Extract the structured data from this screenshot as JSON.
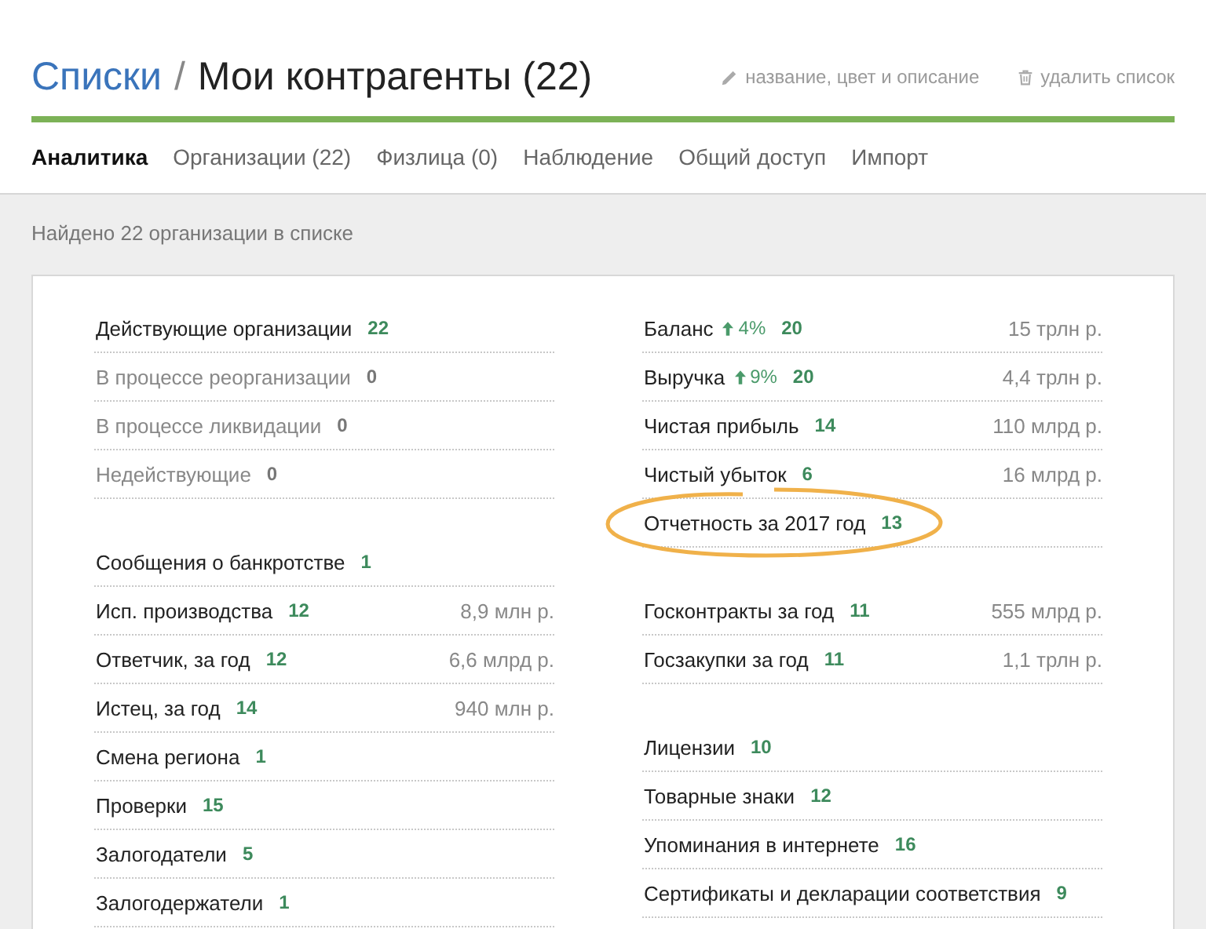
{
  "header": {
    "breadcrumb_link": "Списки",
    "separator": "/",
    "title": "Мои контрагенты (22)",
    "actions": [
      {
        "kind": "edit",
        "label": "название, цвет и описание"
      },
      {
        "kind": "delete",
        "label": "удалить список"
      }
    ]
  },
  "tabs": [
    {
      "label": "Аналитика",
      "selected": true
    },
    {
      "label": "Организации (22)",
      "selected": false
    },
    {
      "label": "Физлица (0)",
      "selected": false
    },
    {
      "label": "Наблюдение",
      "selected": false
    },
    {
      "label": "Общий доступ",
      "selected": false
    },
    {
      "label": "Импорт",
      "selected": false
    }
  ],
  "summary": "Найдено 22 организации в списке",
  "columns": [
    {
      "groups": [
        {
          "rows": [
            {
              "label": "Действующие организации",
              "count": "22",
              "dimmed": false,
              "highlighted": false
            },
            {
              "label": "В процессе реорганизации",
              "count": "0",
              "dimmed": true,
              "highlighted": false
            },
            {
              "label": "В процессе ликвидации",
              "count": "0",
              "dimmed": true,
              "highlighted": false
            },
            {
              "label": "Недействующие",
              "count": "0",
              "dimmed": true,
              "highlighted": false
            }
          ]
        },
        {
          "rows": [
            {
              "label": "Сообщения о банкротстве",
              "count": "1",
              "dimmed": false,
              "highlighted": false
            },
            {
              "label": "Исп. производства",
              "count": "12",
              "amount": "8,9 млн р.",
              "dimmed": false,
              "highlighted": false
            },
            {
              "label": "Ответчик, за год",
              "count": "12",
              "amount": "6,6 млрд р.",
              "dimmed": false,
              "highlighted": false
            },
            {
              "label": "Истец, за год",
              "count": "14",
              "amount": "940 млн р.",
              "dimmed": false,
              "highlighted": false
            },
            {
              "label": "Смена региона",
              "count": "1",
              "dimmed": false,
              "highlighted": false
            },
            {
              "label": "Проверки",
              "count": "15",
              "dimmed": false,
              "highlighted": false
            },
            {
              "label": "Залогодатели",
              "count": "5",
              "dimmed": false,
              "highlighted": false
            },
            {
              "label": "Залогодержатели",
              "count": "1",
              "dimmed": false,
              "highlighted": false
            }
          ]
        }
      ]
    },
    {
      "groups": [
        {
          "rows": [
            {
              "label": "Баланс",
              "change": "4%",
              "count": "20",
              "amount": "15 трлн р.",
              "dimmed": false,
              "highlighted": false
            },
            {
              "label": "Выручка",
              "change": "9%",
              "count": "20",
              "amount": "4,4 трлн р.",
              "dimmed": false,
              "highlighted": false
            },
            {
              "label": "Чистая прибыль",
              "count": "14",
              "amount": "110 млрд р.",
              "dimmed": false,
              "highlighted": false
            },
            {
              "label": "Чистый убыток",
              "count": "6",
              "amount": "16 млрд р.",
              "dimmed": false,
              "highlighted": false
            },
            {
              "label": "Отчетность за 2017 год",
              "count": "13",
              "dimmed": false,
              "highlighted": true
            }
          ]
        },
        {
          "rows": [
            {
              "label": "Госконтракты за год",
              "count": "11",
              "amount": "555 млрд р.",
              "dimmed": false,
              "highlighted": false
            },
            {
              "label": "Госзакупки за год",
              "count": "11",
              "amount": "1,1 трлн р.",
              "dimmed": false,
              "highlighted": false
            }
          ]
        },
        {
          "rows": [
            {
              "label": "Лицензии",
              "count": "10",
              "dimmed": false,
              "highlighted": false
            },
            {
              "label": "Товарные знаки",
              "count": "12",
              "dimmed": false,
              "highlighted": false
            },
            {
              "label": "Упоминания в интернете",
              "count": "16",
              "dimmed": false,
              "highlighted": false
            },
            {
              "label": "Сертификаты и декларации соответствия",
              "count": "9",
              "dimmed": false,
              "highlighted": false
            }
          ]
        }
      ]
    }
  ]
}
